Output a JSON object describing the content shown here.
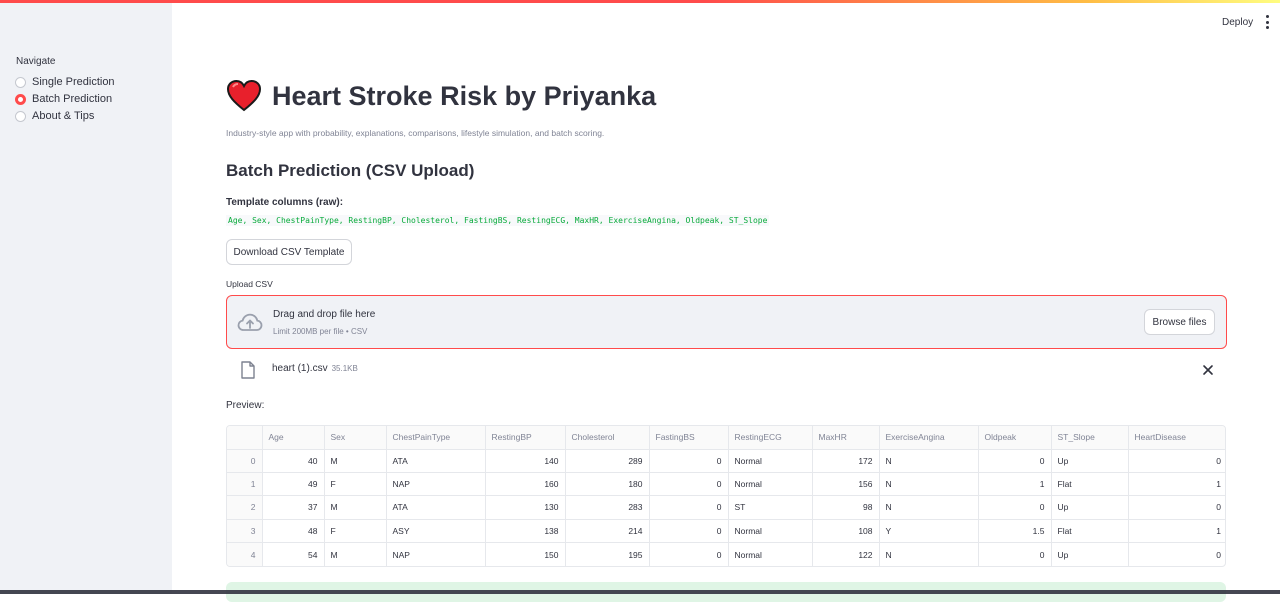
{
  "sidebar": {
    "title": "Navigate",
    "items": [
      {
        "label": "Single Prediction",
        "selected": false
      },
      {
        "label": "Batch Prediction",
        "selected": true
      },
      {
        "label": "About & Tips",
        "selected": false
      }
    ]
  },
  "header": {
    "deploy_label": "Deploy",
    "menu_icon": "kebab-menu-icon"
  },
  "main": {
    "title": "Heart Stroke Risk by Priyanka",
    "title_icon": "heart-emoji-icon",
    "caption": "Industry-style app with probability, explanations, comparisons, lifestyle simulation, and batch scoring.",
    "section_title": "Batch Prediction (CSV Upload)",
    "template_label": "Template columns (raw):",
    "template_columns": "Age, Sex, ChestPainType, RestingBP, Cholesterol, FastingBS, RestingECG, MaxHR, ExerciseAngina, Oldpeak, ST_Slope",
    "download_button": "Download CSV Template",
    "upload_label": "Upload CSV",
    "dropzone": {
      "main": "Drag and drop file here",
      "sub": "Limit 200MB per file • CSV",
      "browse": "Browse files",
      "icon": "cloud-upload-icon"
    },
    "file": {
      "name": "heart (1).csv",
      "size": "35.1KB",
      "icon": "file-icon",
      "close_icon": "close-icon"
    },
    "preview_label": "Preview:",
    "table": {
      "columns": [
        "",
        "Age",
        "Sex",
        "ChestPainType",
        "RestingBP",
        "Cholesterol",
        "FastingBS",
        "RestingECG",
        "MaxHR",
        "ExerciseAngina",
        "Oldpeak",
        "ST_Slope",
        "HeartDisease"
      ],
      "rows": [
        [
          "0",
          "40",
          "M",
          "ATA",
          "140",
          "289",
          "0",
          "Normal",
          "172",
          "N",
          "0",
          "Up",
          "0"
        ],
        [
          "1",
          "49",
          "F",
          "NAP",
          "160",
          "180",
          "0",
          "Normal",
          "156",
          "N",
          "1",
          "Flat",
          "1"
        ],
        [
          "2",
          "37",
          "M",
          "ATA",
          "130",
          "283",
          "0",
          "ST",
          "98",
          "N",
          "0",
          "Up",
          "0"
        ],
        [
          "3",
          "48",
          "F",
          "ASY",
          "138",
          "214",
          "0",
          "Normal",
          "108",
          "Y",
          "1.5",
          "Flat",
          "1"
        ],
        [
          "4",
          "54",
          "M",
          "NAP",
          "150",
          "195",
          "0",
          "Normal",
          "122",
          "N",
          "0",
          "Up",
          "0"
        ]
      ]
    }
  },
  "colors": {
    "accent": "#ff4b4b",
    "sidebar_bg": "#f0f2f6",
    "code_green": "#09ab3b",
    "success_bg": "#dff5e5"
  }
}
